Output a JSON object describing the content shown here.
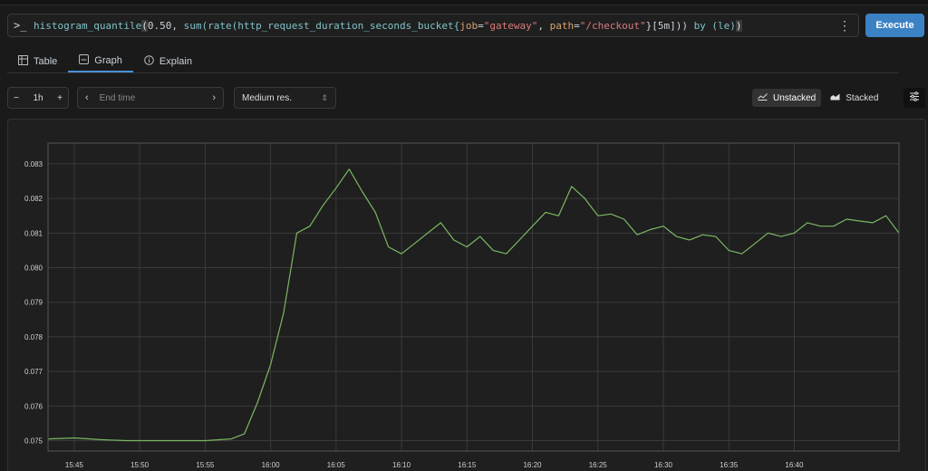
{
  "query": {
    "prompt_icon": "terminal-prompt-icon",
    "fn1": "histogram_quantile",
    "paren_open": "(",
    "arg_num": "0.50, ",
    "fn2": "sum(rate(http_request_duration_seconds_bucket{",
    "label1_key": "job",
    "label1_eq": "=",
    "label1_val": "\"gateway\"",
    "sep": ", ",
    "label2_key": "path",
    "label2_eq": "=",
    "label2_val": "\"/checkout\"",
    "tail": "}[5m])) ",
    "by": "by (le)",
    "paren_close": ")",
    "menu_icon": "kebab-menu-icon"
  },
  "execute_label": "Execute",
  "tabs": [
    {
      "label": "Table",
      "icon": "table-icon",
      "active": false
    },
    {
      "label": "Graph",
      "icon": "graph-icon",
      "active": true
    },
    {
      "label": "Explain",
      "icon": "info-icon",
      "active": false
    }
  ],
  "controls": {
    "range_minus": "−",
    "range_value": "1h",
    "range_plus": "+",
    "end_time_placeholder": "End time",
    "resolution": "Medium res.",
    "unstacked_label": "Unstacked",
    "stacked_label": "Stacked",
    "settings_icon": "sliders-icon"
  },
  "colors": {
    "series": "#7ab863",
    "accent": "#3b82c4"
  },
  "chart_data": {
    "type": "line",
    "y_ticks": [
      "0.083",
      "0.082",
      "0.081",
      "0.080",
      "0.079",
      "0.078",
      "0.077",
      "0.076",
      "0.075"
    ],
    "x_ticks": [
      "15:45",
      "15:50",
      "15:55",
      "16:00",
      "16:05",
      "16:10",
      "16:15",
      "16:20",
      "16:25",
      "16:30",
      "16:35",
      "16:40"
    ],
    "ylim": [
      0.0747,
      0.0836
    ],
    "grid": true,
    "series": [
      {
        "x": [
          -2,
          0,
          2,
          4,
          6,
          8,
          10,
          12,
          13,
          14,
          15,
          16,
          17,
          18,
          19,
          20,
          21,
          22,
          23,
          24,
          25,
          26,
          27,
          28,
          29,
          30,
          31,
          32,
          33,
          34,
          35,
          36,
          37,
          38,
          39,
          40,
          41,
          42,
          43,
          44,
          45,
          46,
          47,
          48,
          49,
          50,
          51,
          52,
          53,
          54,
          55,
          56,
          57,
          58,
          59,
          60,
          61,
          62,
          63
        ],
        "y": [
          0.07505,
          0.07508,
          0.07503,
          0.075,
          0.075,
          0.075,
          0.075,
          0.07505,
          0.0752,
          0.0761,
          0.0772,
          0.0787,
          0.081,
          0.0812,
          0.0818,
          0.0823,
          0.08285,
          0.0822,
          0.0816,
          0.0806,
          0.0804,
          0.0807,
          0.081,
          0.0813,
          0.0808,
          0.0806,
          0.0809,
          0.0805,
          0.0804,
          0.0808,
          0.0812,
          0.0816,
          0.0815,
          0.08235,
          0.082,
          0.0815,
          0.08155,
          0.0814,
          0.08095,
          0.0811,
          0.0812,
          0.0809,
          0.0808,
          0.08095,
          0.0809,
          0.0805,
          0.0804,
          0.0807,
          0.081,
          0.0809,
          0.081,
          0.0813,
          0.0812,
          0.0812,
          0.0814,
          0.08135,
          0.0813,
          0.0815,
          0.081
        ]
      }
    ]
  }
}
